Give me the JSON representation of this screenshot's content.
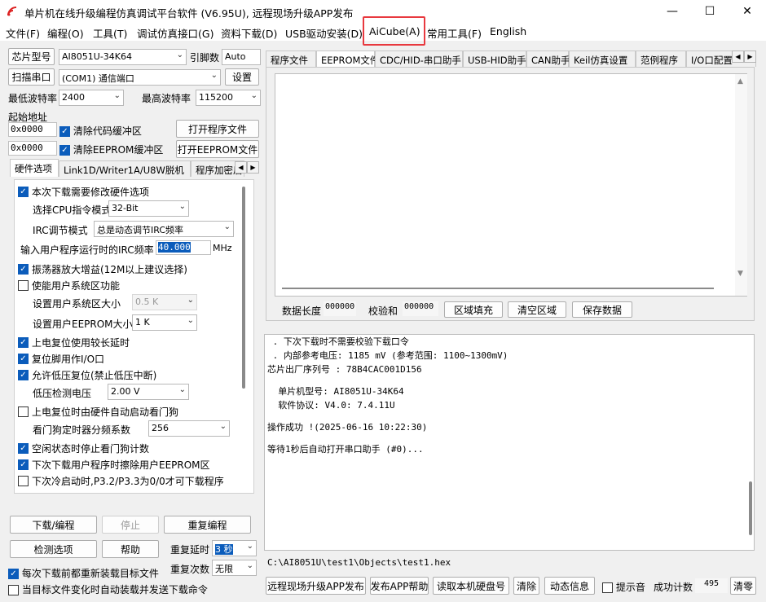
{
  "window": {
    "title": "单片机在线升级编程仿真调试平台软件 (V6.95U), 远程现场升级APP发布",
    "icons": [
      "app-logo-icon",
      "minimize-icon",
      "maximize-icon",
      "close-icon"
    ]
  },
  "menu": [
    "文件(F)",
    "编程(O)",
    "工具(T)",
    "调试仿真接口(G)",
    "资料下载(D)",
    "USB驱动安装(D)",
    "AiCube(A)",
    "常用工具(F)",
    "English"
  ],
  "highlight_color": "#e8393f",
  "left": {
    "chip_label": "芯片型号",
    "chip_value": "AI8051U-34K64",
    "pin_label": "引脚数",
    "pin_value": "Auto",
    "scan_button": "扫描串口",
    "port_value": "(COM1) 通信端口",
    "settings_button": "设置",
    "min_baud_label": "最低波特率",
    "min_baud_value": "2400",
    "max_baud_label": "最高波特率",
    "max_baud_value": "115200",
    "start_addr_label": "起始地址",
    "addr1": "0x0000",
    "clear_code_label": "清除代码缓冲区",
    "open_prog_button": "打开程序文件",
    "addr2": "0x0000",
    "clear_eeprom_label": "清除EEPROM缓冲区",
    "open_eeprom_button": "打开EEPROM文件",
    "tabs": [
      "硬件选项",
      "Link1D/Writer1A/U8W脱机",
      "程序加密后"
    ],
    "hw": {
      "modify_hw": "本次下载需要修改硬件选项",
      "cpu_mode_label": "选择CPU指令模式",
      "cpu_mode_value": "32-Bit",
      "irc_mode_label": "IRC调节模式",
      "irc_mode_value": "总是动态调节IRC频率",
      "irc_freq_label": "输入用户程序运行时的IRC频率",
      "irc_freq_value": "40.000",
      "irc_unit": "MHz",
      "osc_gain": "振荡器放大增益(12M以上建议选择)",
      "user_sys": "使能用户系统区功能",
      "user_sys_size_label": "设置用户系统区大小",
      "user_sys_size_value": "0.5 K",
      "eeprom_size_label": "设置用户EEPROM大小",
      "eeprom_size_value": "1   K",
      "long_delay": "上电复位使用较长延时",
      "reset_io": "复位脚用作I/O口",
      "low_volt_reset": "允许低压复位(禁止低压中断)",
      "low_volt_label": "低压检测电压",
      "low_volt_value": "2.00 V",
      "wdt_auto": "上电复位时由硬件自动启动看门狗",
      "wdt_div_label": "看门狗定时器分频系数",
      "wdt_div_value": "256",
      "wdt_idle": "空闲状态时停止看门狗计数",
      "erase_eeprom": "下次下载用户程序时擦除用户EEPROM区",
      "p32p33": "下次冷启动时,P3.2/P3.3为0/0才可下载程序"
    },
    "download_button": "下载/编程",
    "stop_button": "停止",
    "reprogram_button": "重复编程",
    "check_button": "检测选项",
    "help_button": "帮助",
    "repeat_delay_label": "重复延时",
    "repeat_delay_value": "3 秒",
    "repeat_count_label": "重复次数",
    "repeat_count_value": "无限",
    "reload_label": "每次下载前都重新装载目标文件",
    "auto_send_label": "当目标文件变化时自动装载并发送下载命令"
  },
  "right": {
    "tabs": [
      "程序文件",
      "EEPROM文件",
      "CDC/HID-串口助手",
      "USB-HID助手",
      "CAN助手",
      "Keil仿真设置",
      "范例程序",
      "I/O口配置"
    ],
    "data_len_label": "数据长度",
    "data_len_value": "000000",
    "checksum_label": "校验和",
    "checksum_value": "000000",
    "fill_button": "区域填充",
    "clear_button": "清空区域",
    "save_button": "保存数据",
    "log": [
      " . 下次下载时不需要校验下载口令",
      " . 内部参考电压: 1185 mV (参考范围: 1100~1300mV)",
      "芯片出厂序列号 : 78B4CAC001D156",
      "",
      "  单片机型号: AI8051U-34K64",
      "  软件协议: V4.0: 7.4.11U",
      "",
      "操作成功 !(2025-06-16 10:22:30)",
      "",
      "等待1秒后自动打开串口助手 (#0)..."
    ],
    "file_path": "C:\\AI8051U\\test1\\Objects\\test1.hex",
    "publish_button": "远程现场升级APP发布",
    "publish_help_button": "发布APP帮助",
    "read_disk_button": "读取本机硬盘号",
    "clear_log_button": "清除",
    "dyn_info_button": "动态信息",
    "beep_label": "提示音",
    "success_label": "成功计数",
    "success_value": "495",
    "clear_count_button": "清零"
  }
}
